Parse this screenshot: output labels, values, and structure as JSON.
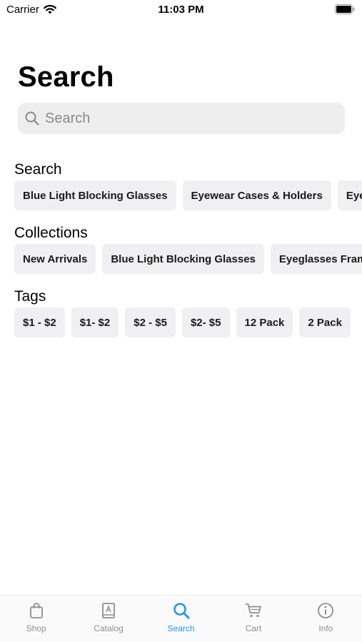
{
  "status_bar": {
    "carrier": "Carrier",
    "time": "11:03 PM"
  },
  "page_title": "Search",
  "search": {
    "placeholder": "Search",
    "value": ""
  },
  "sections": {
    "search": {
      "title": "Search",
      "chips": [
        "Blue Light Blocking Glasses",
        "Eyewear Cases & Holders",
        "Eyewear"
      ]
    },
    "collections": {
      "title": "Collections",
      "chips": [
        "New Arrivals",
        "Blue Light Blocking Glasses",
        "Eyeglasses Frames"
      ]
    },
    "tags": {
      "title": "Tags",
      "chips": [
        "$1 - $2",
        "$1- $2",
        "$2 - $5",
        "$2- $5",
        "12 Pack",
        "2 Pack"
      ]
    }
  },
  "tab_bar": {
    "active_color": "#2196f3",
    "inactive_color": "#8e8e93",
    "tabs": [
      {
        "label": "Shop",
        "icon": "shopping-bag-icon"
      },
      {
        "label": "Catalog",
        "icon": "catalog-book-icon"
      },
      {
        "label": "Search",
        "icon": "search-icon",
        "active": true
      },
      {
        "label": "Cart",
        "icon": "cart-icon"
      },
      {
        "label": "Info",
        "icon": "info-icon"
      }
    ]
  }
}
